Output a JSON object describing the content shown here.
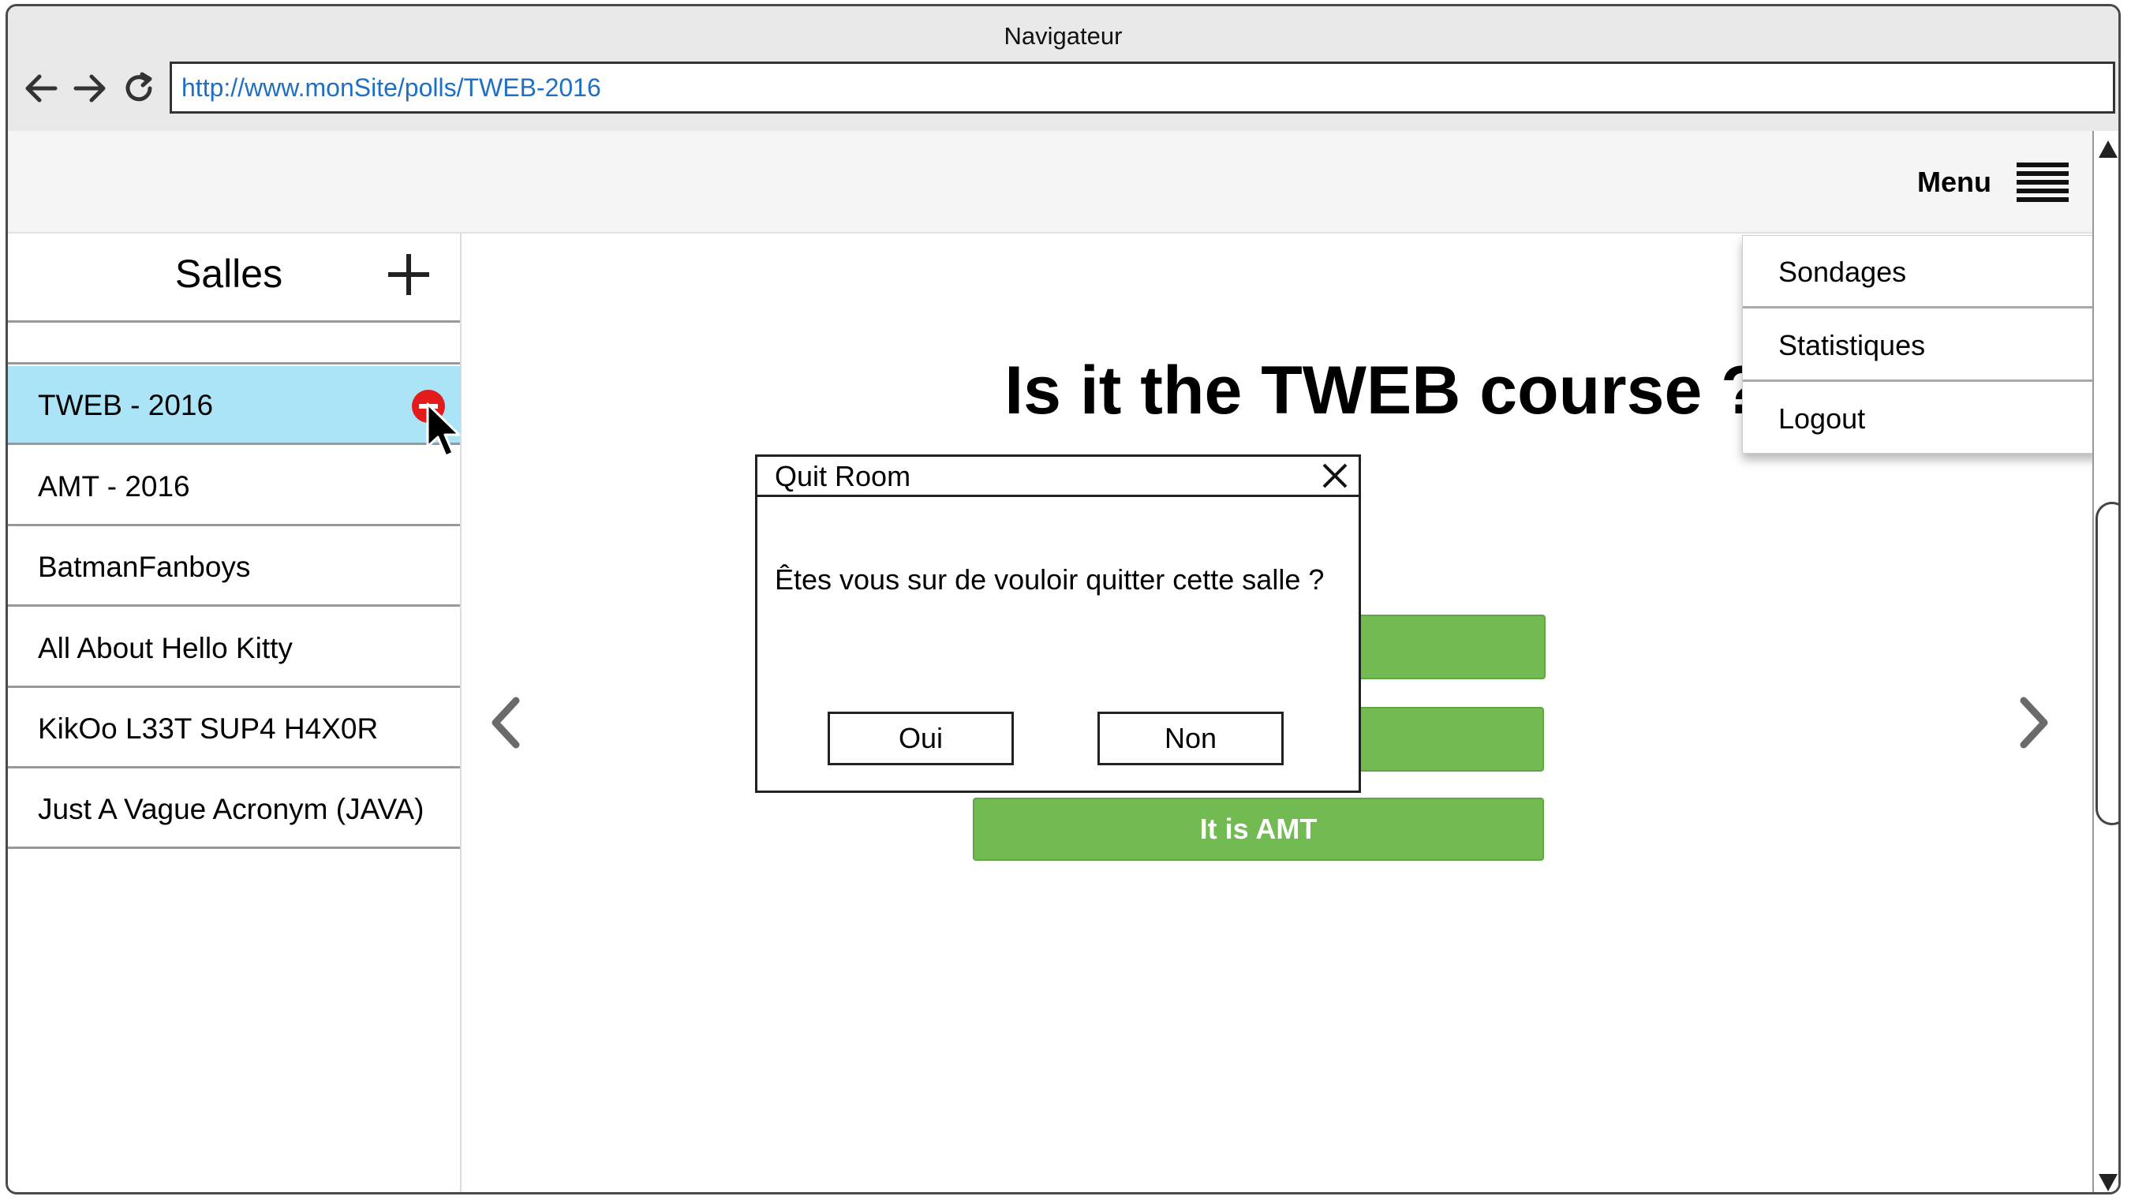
{
  "browser": {
    "title": "Navigateur",
    "url": "http://www.monSite/polls/TWEB-2016"
  },
  "header": {
    "menu_label": "Menu"
  },
  "sidebar": {
    "title": "Salles",
    "rooms": [
      {
        "label": "TWEB - 2016",
        "active": true
      },
      {
        "label": "AMT - 2016"
      },
      {
        "label": "BatmanFanboys"
      },
      {
        "label": "All About Hello Kitty"
      },
      {
        "label": "KikOo L33T SUP4 H4X0R"
      },
      {
        "label": "Just A Vague Acronym (JAVA)"
      }
    ]
  },
  "main": {
    "question": "Is it the TWEB course ?",
    "answers": [
      "",
      "",
      "It is AMT"
    ]
  },
  "dropdown_menu": {
    "items": [
      "Sondages",
      "Statistiques",
      "Logout"
    ]
  },
  "dialog": {
    "title": "Quit Room",
    "message": "Êtes vous sur de vouloir quitter cette salle ?",
    "yes_label": "Oui",
    "no_label": "Non"
  },
  "colors": {
    "active_room": "#abe4f6",
    "answer_green": "#72bb53",
    "remove_red": "#e31b1b",
    "url_blue": "#1f6fc5"
  }
}
